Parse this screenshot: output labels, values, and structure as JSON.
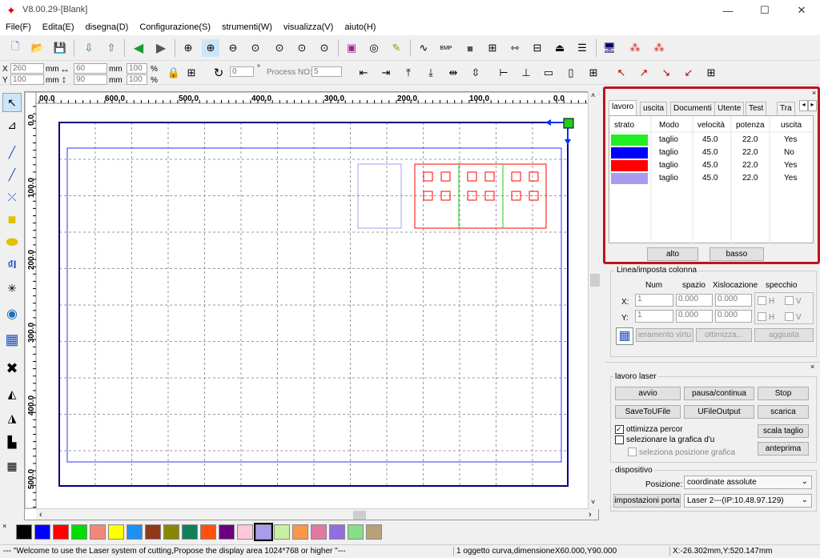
{
  "window": {
    "title": "V8.00.29-[Blank]",
    "minimize": "—",
    "maximize": "☐",
    "close": "✕"
  },
  "menu": [
    "File(F)",
    "Edita(E)",
    "disegna(D)",
    "Configurazione(S)",
    "strumenti(W)",
    "visualizza(V)",
    "aiuto(H)"
  ],
  "position": {
    "x_label": "X",
    "y_label": "Y",
    "x": "260",
    "y": "100",
    "unit": "mm",
    "width": "60",
    "height": "90",
    "scale_x": "100",
    "scale_y": "100",
    "percent": "%"
  },
  "rotation": {
    "value": "0",
    "degree": "°",
    "process_label": "Process NO:",
    "process_value": "5"
  },
  "ruler": {
    "top": [
      "00.0",
      "600.0",
      "500.0",
      "400.0",
      "300.0",
      "200.0",
      "100.0",
      "0.0"
    ],
    "left": [
      "0.0",
      "100.0",
      "200.0",
      "300.0",
      "400.0",
      "500.0"
    ]
  },
  "panel": {
    "tabs": [
      "lavoro",
      "uscita",
      "Documenti",
      "Utente",
      "Test",
      "Tra"
    ],
    "columns": [
      "strato",
      "Modo",
      "velocità",
      "potenza",
      "uscita"
    ],
    "layers": [
      {
        "color": "#22ee22",
        "mode": "taglio",
        "speed": "45.0",
        "power": "22.0",
        "output": "Yes"
      },
      {
        "color": "#0000ff",
        "mode": "taglio",
        "speed": "45.0",
        "power": "22.0",
        "output": "No"
      },
      {
        "color": "#ff0000",
        "mode": "taglio",
        "speed": "45.0",
        "power": "22.0",
        "output": "Yes"
      },
      {
        "color": "#a89cf0",
        "mode": "taglio",
        "speed": "45.0",
        "power": "22.0",
        "output": "Yes"
      }
    ],
    "up": "alto",
    "down": "basso"
  },
  "array": {
    "title": "Linea/imposta colonna",
    "num": "Num",
    "spacing": "spazio",
    "offset": "Xislocazione",
    "mirror": "specchio",
    "x_label": "X:",
    "y_label": "Y:",
    "x_num": "1",
    "x_space": "0.000",
    "x_offset": "0.000",
    "y_num": "1",
    "y_space": "0.000",
    "y_offset": "0.000",
    "h": "H",
    "v": "V",
    "virtual": "ieramento virtu",
    "optimize": "ottimizza...",
    "update": "aggiusta"
  },
  "laser": {
    "title": "lavoro laser",
    "start": "avvio",
    "pause": "pausa/continua",
    "stop": "Stop",
    "save": "SaveToUFile",
    "ufile": "UFileOutput",
    "download": "scarica",
    "opt_path": "ottimizza percor",
    "select_graphic": "selezionare la grafica d'u",
    "select_pos": "seleziona posizione grafica",
    "scale": "scala taglio",
    "preview": "anteprima"
  },
  "device": {
    "title": "dispositivo",
    "position_label": "Posizione:",
    "position_value": "coordinate assolute",
    "settings": "impostazioni porta",
    "laser_value": "Laser 2---(IP:10.48.97.129)"
  },
  "palette": [
    "#000000",
    "#0000ff",
    "#ff0000",
    "#00dd00",
    "#f08878",
    "#ffff00",
    "#2090f0",
    "#903818",
    "#888800",
    "#108058",
    "#ff5010",
    "#6a0080",
    "#ffc8d8",
    "#a89cf0",
    "#c8f0a0",
    "#f89848",
    "#e078a0",
    "#9070e0",
    "#88dd88",
    "#b8a078"
  ],
  "status": {
    "left": "--- \"Welcome to use the Laser system of cutting,Propose the display area 1024*768 or higher \"---",
    "middle": "1 oggetto curva,dimensioneX60.000,Y90.000",
    "right": "X:-26.302mm,Y:520.147mm"
  }
}
